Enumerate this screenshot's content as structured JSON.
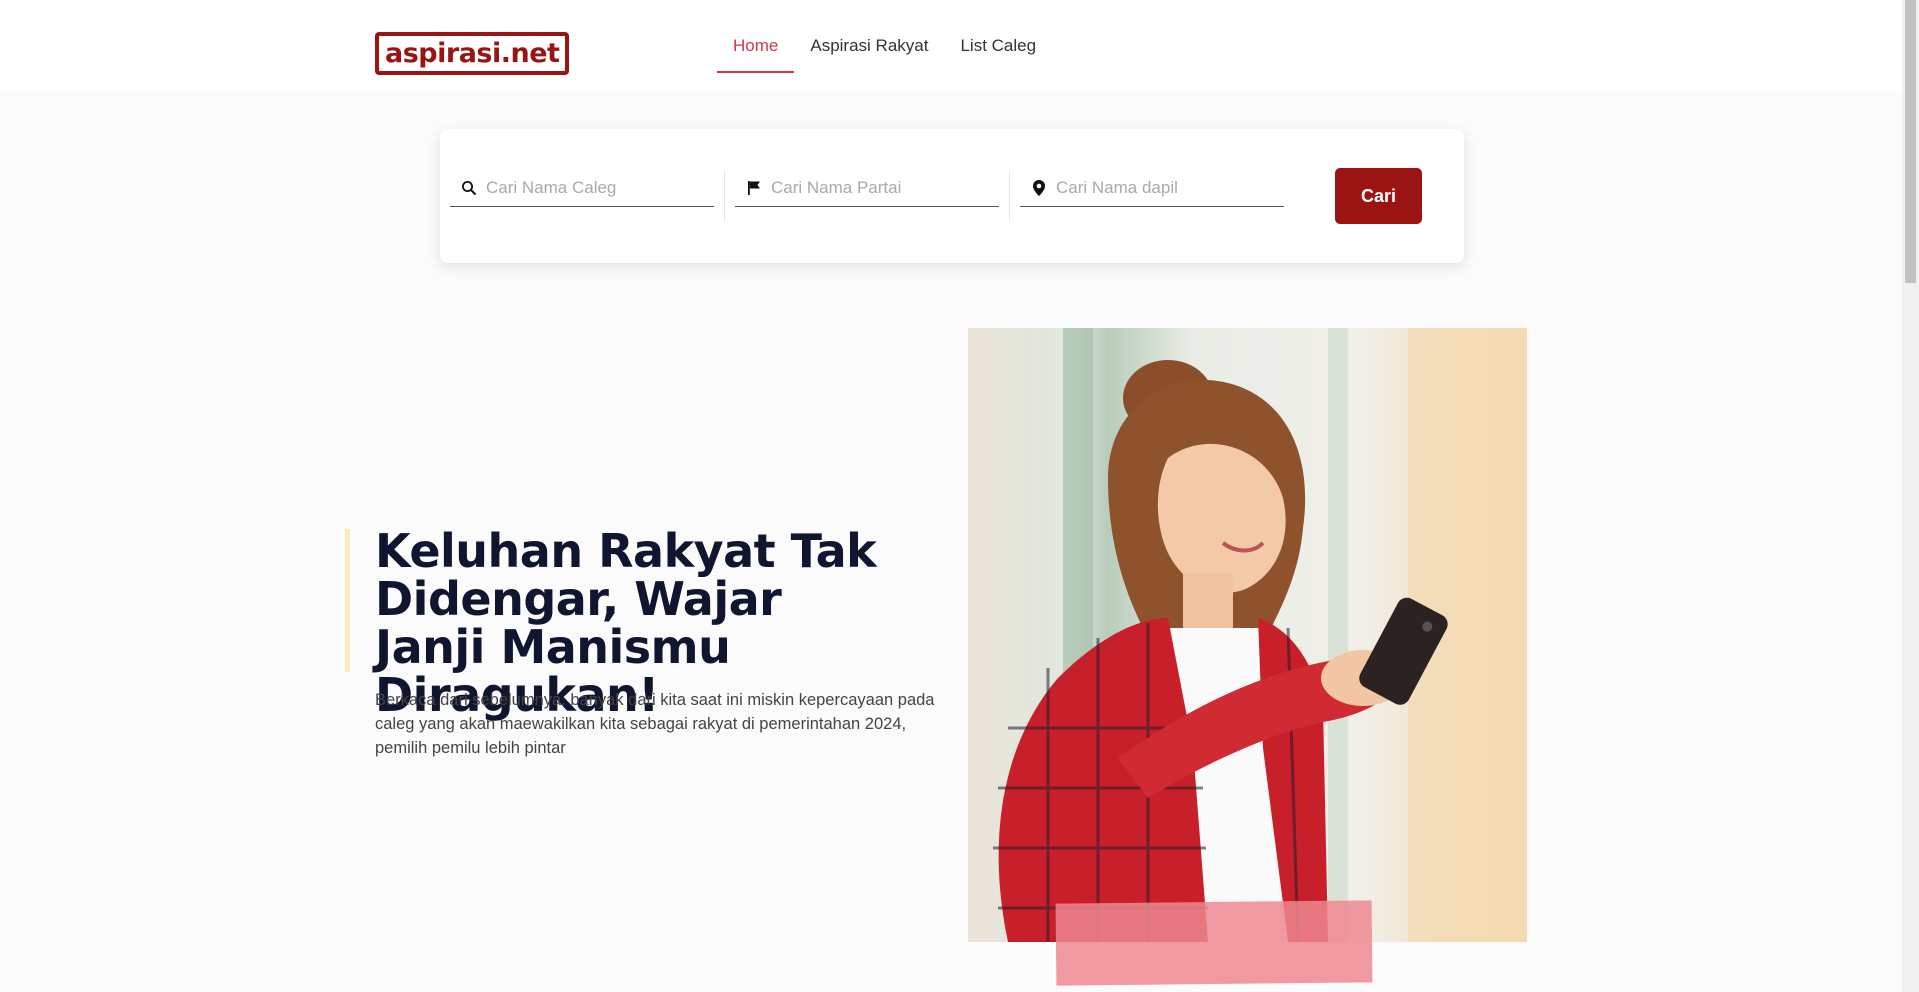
{
  "brand": {
    "logo_text": "aspirasi.net",
    "accent_color": "#9b1414",
    "active_color": "#d2354a"
  },
  "nav": {
    "items": [
      {
        "label": "Home",
        "active": true
      },
      {
        "label": "Aspirasi Rakyat",
        "active": false
      },
      {
        "label": "List Caleg",
        "active": false
      }
    ]
  },
  "search": {
    "caleg_placeholder": "Cari Nama Caleg",
    "caleg_icon": "search-icon",
    "partai_placeholder": "Cari Nama Partai",
    "partai_icon": "flag-icon",
    "dapil_placeholder": "Cari Nama dapil",
    "dapil_icon": "location-pin-icon",
    "button_label": "Cari"
  },
  "hero": {
    "title": "Keluhan Rakyat Tak Didengar, Wajar Janji Manismu Diragukan!",
    "description": "Berkaca dari sebelumnya, banyak dari kita saat ini miskin kepercayaan pada caleg yang akan maewakilkan kita sebagai rakyat di pemerintahan 2024, pemilih pemilu lebih pintar"
  }
}
